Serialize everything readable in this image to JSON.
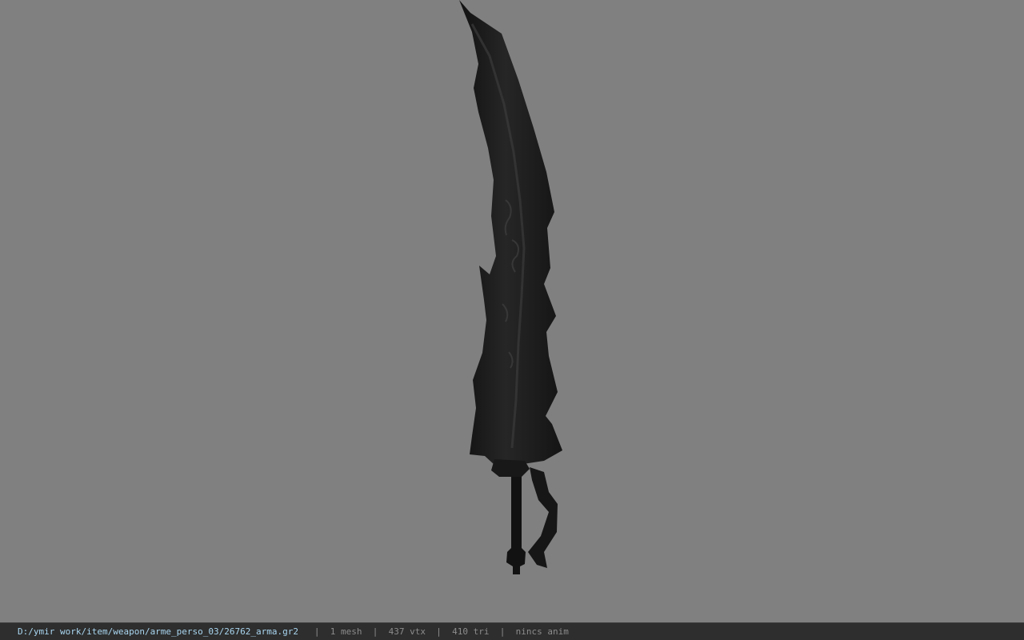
{
  "viewport": {
    "model_icon": "curved-sword-model",
    "background_color": "#808080",
    "model_color": "#1a1a1a"
  },
  "status_bar": {
    "file_path": "D:/ymir work/item/weapon/arme_perso_03/26762_arma.gr2",
    "separator": "|",
    "mesh_count": "1 mesh",
    "vertex_count": "437 vtx",
    "triangle_count": "410 tri",
    "anim_status": "nincs anim"
  }
}
